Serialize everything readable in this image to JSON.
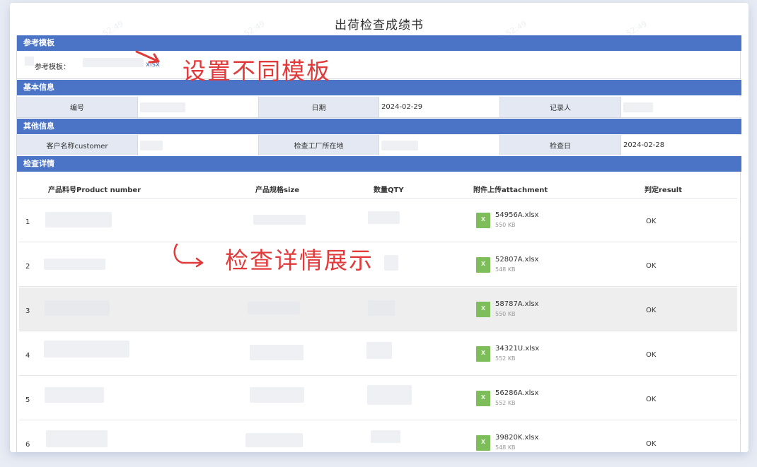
{
  "page_title": "出荷检查成绩书",
  "sections": {
    "template": "参考模板",
    "basic": "基本信息",
    "other": "其他信息",
    "details": "检查详情"
  },
  "template": {
    "label": "参考模板：",
    "file_ext": "xlsx"
  },
  "basic_info": {
    "number_label": "编号",
    "date_label": "日期",
    "date_value": "2024-02-29",
    "recorder_label": "记录人"
  },
  "other_info": {
    "customer_label": "客户名称customer",
    "factory_label": "检查工厂所在地",
    "inspection_date_label": "检查日",
    "inspection_date_value": "2024-02-28"
  },
  "table": {
    "columns": [
      "产品料号Product number",
      "产品规格size",
      "数量QTY",
      "附件上传attachment",
      "判定result"
    ],
    "rows": [
      {
        "index": "1",
        "file_name": "54956A.xlsx",
        "file_size": "550 KB",
        "result": "OK"
      },
      {
        "index": "2",
        "file_name": "52807A.xlsx",
        "file_size": "548 KB",
        "result": "OK"
      },
      {
        "index": "3",
        "file_name": "58787A.xlsx",
        "file_size": "550 KB",
        "result": "OK"
      },
      {
        "index": "4",
        "file_name": "34321U.xlsx",
        "file_size": "552 KB",
        "result": "OK"
      },
      {
        "index": "5",
        "file_name": "56286A.xlsx",
        "file_size": "552 KB",
        "result": "OK"
      },
      {
        "index": "6",
        "file_name": "39820K.xlsx",
        "file_size": "548 KB",
        "result": "OK"
      }
    ]
  },
  "annotations": {
    "template_note": "设置不同模板",
    "details_note": "检查详情展示"
  },
  "colors": {
    "section_header": "#4b74c6",
    "label_cell": "#e3e8f2",
    "annotation": "#e03a3a",
    "excel_icon": "#7dbd5a"
  }
}
